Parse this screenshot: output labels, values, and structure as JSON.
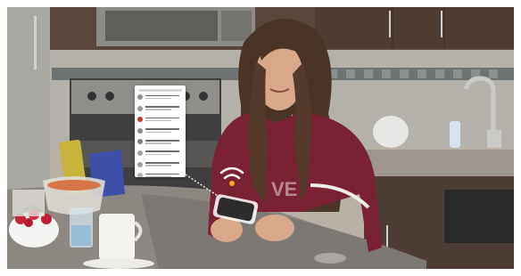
{
  "scene": {
    "description_free": true,
    "colors": {
      "frame": "#ffffff",
      "cabinet": "#5a463b",
      "backsplash": "#a7a7a3",
      "countertop": "#8e8883",
      "sweater": "#7a2233",
      "hair": "#4a3426",
      "skin": "#d9a88b",
      "phone": "#2b2b2b",
      "wifi_glow": "#ffffff",
      "accent_orange": "#f5a623"
    }
  },
  "notification_card": {
    "row_count": 8,
    "avatar_colors": [
      "#8e8e8e",
      "#9a9a9a",
      "#c0392b",
      "#8a8a8a",
      "#7e7e7e",
      "#a0a0a0",
      "#9e9e9e",
      "#b0b0b0"
    ]
  },
  "icons": {
    "wifi": "wifi-icon",
    "phone": "smartphone-icon"
  }
}
